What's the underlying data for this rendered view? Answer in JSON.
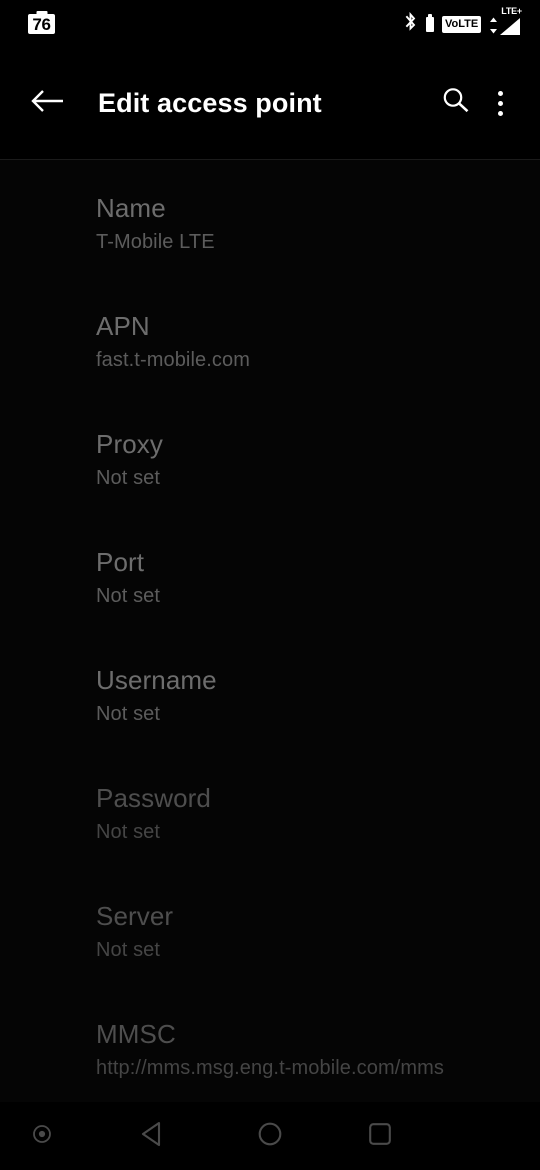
{
  "status_bar": {
    "battery_percent": "76",
    "bluetooth_icon": "bluetooth-icon",
    "headset_battery_icon": "battery-small-icon",
    "volte_label": "VoLTE",
    "network_type": "LTE+",
    "data_arrows_icon": "data-transfer-arrows-icon",
    "signal_icon": "signal-bars-icon"
  },
  "app_bar": {
    "back_icon": "arrow-left-icon",
    "title": "Edit access point",
    "search_icon": "search-icon",
    "overflow_icon": "more-vertical-icon"
  },
  "preferences": [
    {
      "title": "Name",
      "summary": "T-Mobile LTE"
    },
    {
      "title": "APN",
      "summary": "fast.t-mobile.com"
    },
    {
      "title": "Proxy",
      "summary": "Not set"
    },
    {
      "title": "Port",
      "summary": "Not set"
    },
    {
      "title": "Username",
      "summary": "Not set"
    },
    {
      "title": "Password",
      "summary": "Not set"
    },
    {
      "title": "Server",
      "summary": "Not set"
    },
    {
      "title": "MMSC",
      "summary": "http://mms.msg.eng.t-mobile.com/mms"
    }
  ],
  "nav_bar": {
    "assistant_icon": "assistant-circle-icon",
    "back_icon": "triangle-back-icon",
    "home_icon": "circle-home-icon",
    "recents_icon": "square-recents-icon"
  },
  "colors": {
    "background": "#000000",
    "content_background": "#050505",
    "title_text": "#ffffff",
    "pref_title_text": "#6d6d6d",
    "pref_summary_text": "#5c5c5c",
    "divider": "#1b1b1b",
    "nav_icon": "#4a4a4a"
  }
}
